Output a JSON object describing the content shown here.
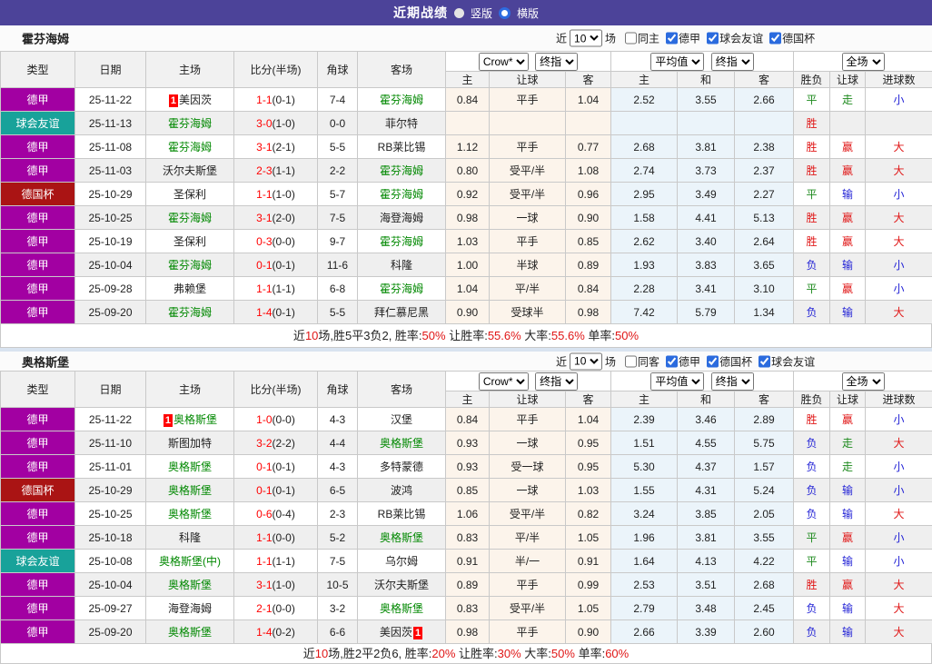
{
  "topbar": {
    "title": "近期战绩",
    "radio_vertical": "竖版",
    "radio_horizontal": "横版",
    "selected_layout": "竖版"
  },
  "labels": {
    "near": "近",
    "matches": "场"
  },
  "columns": {
    "type": "类型",
    "date": "日期",
    "home": "主场",
    "score": "比分(半场)",
    "corners": "角球",
    "away": "客场",
    "odds_home": "主",
    "odds_handicap": "让球",
    "odds_away": "客",
    "avg_home": "主",
    "avg_draw": "和",
    "avg_away": "客",
    "res_wdl": "胜负",
    "res_handicap": "让球",
    "res_goals": "进球数"
  },
  "colors": {
    "topbar_bg": "#4C4399",
    "league": "#A200A2",
    "friendly": "#18A29A",
    "cup": "#AA1414",
    "win_red": "#E01616",
    "draw_green": "#1E8A1E",
    "lose_blue": "#2424D6",
    "self_team_green": "#008800",
    "score_red": "#FF0000",
    "odds_bg": "#FCF4EB",
    "avg_bg": "#EBF4FA"
  },
  "sections": [
    {
      "team": "霍芬海姆",
      "filter": {
        "count": "10",
        "same": "同主",
        "same_checked": false,
        "comps": [
          {
            "label": "德甲",
            "checked": true
          },
          {
            "label": "球会友谊",
            "checked": true
          },
          {
            "label": "德国杯",
            "checked": true
          }
        ]
      },
      "selects": {
        "odds_source": "Crow*",
        "odds_type": "终指",
        "avg_source": "平均值",
        "avg_type": "终指",
        "scope": "全场"
      },
      "rows": [
        {
          "type": "德甲",
          "tc": "lg",
          "date": "25-11-22",
          "home": {
            "t": "美因茨",
            "self": false,
            "badge": "pre"
          },
          "score": "1-1",
          "half": "(0-1)",
          "corners": "7-4",
          "away": {
            "t": "霍芬海姆",
            "self": true
          },
          "odds": [
            "0.84",
            "平手",
            "1.04"
          ],
          "avg": [
            "2.52",
            "3.55",
            "2.66"
          ],
          "res": [
            {
              "t": "平",
              "c": "g"
            },
            {
              "t": "走",
              "c": "g"
            },
            {
              "t": "小",
              "c": "b"
            }
          ]
        },
        {
          "type": "球会友谊",
          "tc": "fr",
          "date": "25-11-13",
          "home": {
            "t": "霍芬海姆",
            "self": true
          },
          "score": "3-0",
          "half": "(1-0)",
          "corners": "0-0",
          "away": {
            "t": "菲尔特",
            "self": false
          },
          "odds": [
            "",
            "",
            ""
          ],
          "avg": [
            "",
            "",
            ""
          ],
          "res": [
            {
              "t": "胜",
              "c": "r"
            },
            {
              "t": "",
              "c": "k"
            },
            {
              "t": "",
              "c": "k"
            }
          ]
        },
        {
          "type": "德甲",
          "tc": "lg",
          "date": "25-11-08",
          "home": {
            "t": "霍芬海姆",
            "self": true
          },
          "score": "3-1",
          "half": "(2-1)",
          "corners": "5-5",
          "away": {
            "t": "RB莱比锡",
            "self": false
          },
          "odds": [
            "1.12",
            "平手",
            "0.77"
          ],
          "avg": [
            "2.68",
            "3.81",
            "2.38"
          ],
          "res": [
            {
              "t": "胜",
              "c": "r"
            },
            {
              "t": "赢",
              "c": "r"
            },
            {
              "t": "大",
              "c": "r"
            }
          ]
        },
        {
          "type": "德甲",
          "tc": "lg",
          "date": "25-11-03",
          "home": {
            "t": "沃尔夫斯堡",
            "self": false
          },
          "score": "2-3",
          "half": "(1-1)",
          "corners": "2-2",
          "away": {
            "t": "霍芬海姆",
            "self": true
          },
          "odds": [
            "0.80",
            "受平/半",
            "1.08"
          ],
          "avg": [
            "2.74",
            "3.73",
            "2.37"
          ],
          "res": [
            {
              "t": "胜",
              "c": "r"
            },
            {
              "t": "赢",
              "c": "r"
            },
            {
              "t": "大",
              "c": "r"
            }
          ]
        },
        {
          "type": "德国杯",
          "tc": "cup",
          "date": "25-10-29",
          "home": {
            "t": "圣保利",
            "self": false
          },
          "score": "1-1",
          "half": "(1-0)",
          "corners": "5-7",
          "away": {
            "t": "霍芬海姆",
            "self": true
          },
          "odds": [
            "0.92",
            "受平/半",
            "0.96"
          ],
          "avg": [
            "2.95",
            "3.49",
            "2.27"
          ],
          "res": [
            {
              "t": "平",
              "c": "g"
            },
            {
              "t": "输",
              "c": "b"
            },
            {
              "t": "小",
              "c": "b"
            }
          ]
        },
        {
          "type": "德甲",
          "tc": "lg",
          "date": "25-10-25",
          "home": {
            "t": "霍芬海姆",
            "self": true
          },
          "score": "3-1",
          "half": "(2-0)",
          "corners": "7-5",
          "away": {
            "t": "海登海姆",
            "self": false
          },
          "odds": [
            "0.98",
            "一球",
            "0.90"
          ],
          "avg": [
            "1.58",
            "4.41",
            "5.13"
          ],
          "res": [
            {
              "t": "胜",
              "c": "r"
            },
            {
              "t": "赢",
              "c": "r"
            },
            {
              "t": "大",
              "c": "r"
            }
          ]
        },
        {
          "type": "德甲",
          "tc": "lg",
          "date": "25-10-19",
          "home": {
            "t": "圣保利",
            "self": false
          },
          "score": "0-3",
          "half": "(0-0)",
          "corners": "9-7",
          "away": {
            "t": "霍芬海姆",
            "self": true
          },
          "odds": [
            "1.03",
            "平手",
            "0.85"
          ],
          "avg": [
            "2.62",
            "3.40",
            "2.64"
          ],
          "res": [
            {
              "t": "胜",
              "c": "r"
            },
            {
              "t": "赢",
              "c": "r"
            },
            {
              "t": "大",
              "c": "r"
            }
          ]
        },
        {
          "type": "德甲",
          "tc": "lg",
          "date": "25-10-04",
          "home": {
            "t": "霍芬海姆",
            "self": true
          },
          "score": "0-1",
          "half": "(0-1)",
          "corners": "11-6",
          "away": {
            "t": "科隆",
            "self": false
          },
          "odds": [
            "1.00",
            "半球",
            "0.89"
          ],
          "avg": [
            "1.93",
            "3.83",
            "3.65"
          ],
          "res": [
            {
              "t": "负",
              "c": "b"
            },
            {
              "t": "输",
              "c": "b"
            },
            {
              "t": "小",
              "c": "b"
            }
          ]
        },
        {
          "type": "德甲",
          "tc": "lg",
          "date": "25-09-28",
          "home": {
            "t": "弗赖堡",
            "self": false
          },
          "score": "1-1",
          "half": "(1-1)",
          "corners": "6-8",
          "away": {
            "t": "霍芬海姆",
            "self": true
          },
          "odds": [
            "1.04",
            "平/半",
            "0.84"
          ],
          "avg": [
            "2.28",
            "3.41",
            "3.10"
          ],
          "res": [
            {
              "t": "平",
              "c": "g"
            },
            {
              "t": "赢",
              "c": "r"
            },
            {
              "t": "小",
              "c": "b"
            }
          ]
        },
        {
          "type": "德甲",
          "tc": "lg",
          "date": "25-09-20",
          "home": {
            "t": "霍芬海姆",
            "self": true
          },
          "score": "1-4",
          "half": "(0-1)",
          "corners": "5-5",
          "away": {
            "t": "拜仁慕尼黑",
            "self": false
          },
          "odds": [
            "0.90",
            "受球半",
            "0.98"
          ],
          "avg": [
            "7.42",
            "5.79",
            "1.34"
          ],
          "res": [
            {
              "t": "负",
              "c": "b"
            },
            {
              "t": "输",
              "c": "b"
            },
            {
              "t": "大",
              "c": "r"
            }
          ]
        }
      ],
      "summary": [
        {
          "t": "近",
          "c": "k"
        },
        {
          "t": "10",
          "c": "r"
        },
        {
          "t": "场,胜5平3负2, 胜率:",
          "c": "k"
        },
        {
          "t": "50%",
          "c": "r"
        },
        {
          "t": " 让胜率:",
          "c": "k"
        },
        {
          "t": "55.6%",
          "c": "r"
        },
        {
          "t": " 大率:",
          "c": "k"
        },
        {
          "t": "55.6%",
          "c": "r"
        },
        {
          "t": " 单率:",
          "c": "k"
        },
        {
          "t": "50%",
          "c": "r"
        }
      ]
    },
    {
      "team": "奥格斯堡",
      "filter": {
        "count": "10",
        "same": "同客",
        "same_checked": false,
        "comps": [
          {
            "label": "德甲",
            "checked": true
          },
          {
            "label": "德国杯",
            "checked": true
          },
          {
            "label": "球会友谊",
            "checked": true
          }
        ]
      },
      "selects": {
        "odds_source": "Crow*",
        "odds_type": "终指",
        "avg_source": "平均值",
        "avg_type": "终指",
        "scope": "全场"
      },
      "rows": [
        {
          "type": "德甲",
          "tc": "lg",
          "date": "25-11-22",
          "home": {
            "t": "奥格斯堡",
            "self": true,
            "badge": "pre"
          },
          "score": "1-0",
          "half": "(0-0)",
          "corners": "4-3",
          "away": {
            "t": "汉堡",
            "self": false
          },
          "odds": [
            "0.84",
            "平手",
            "1.04"
          ],
          "avg": [
            "2.39",
            "3.46",
            "2.89"
          ],
          "res": [
            {
              "t": "胜",
              "c": "r"
            },
            {
              "t": "赢",
              "c": "r"
            },
            {
              "t": "小",
              "c": "b"
            }
          ]
        },
        {
          "type": "德甲",
          "tc": "lg",
          "date": "25-11-10",
          "home": {
            "t": "斯图加特",
            "self": false
          },
          "score": "3-2",
          "half": "(2-2)",
          "corners": "4-4",
          "away": {
            "t": "奥格斯堡",
            "self": true
          },
          "odds": [
            "0.93",
            "一球",
            "0.95"
          ],
          "avg": [
            "1.51",
            "4.55",
            "5.75"
          ],
          "res": [
            {
              "t": "负",
              "c": "b"
            },
            {
              "t": "走",
              "c": "g"
            },
            {
              "t": "大",
              "c": "r"
            }
          ]
        },
        {
          "type": "德甲",
          "tc": "lg",
          "date": "25-11-01",
          "home": {
            "t": "奥格斯堡",
            "self": true
          },
          "score": "0-1",
          "half": "(0-1)",
          "corners": "4-3",
          "away": {
            "t": "多特蒙德",
            "self": false
          },
          "odds": [
            "0.93",
            "受一球",
            "0.95"
          ],
          "avg": [
            "5.30",
            "4.37",
            "1.57"
          ],
          "res": [
            {
              "t": "负",
              "c": "b"
            },
            {
              "t": "走",
              "c": "g"
            },
            {
              "t": "小",
              "c": "b"
            }
          ]
        },
        {
          "type": "德国杯",
          "tc": "cup",
          "date": "25-10-29",
          "home": {
            "t": "奥格斯堡",
            "self": true
          },
          "score": "0-1",
          "half": "(0-1)",
          "corners": "6-5",
          "away": {
            "t": "波鸿",
            "self": false
          },
          "odds": [
            "0.85",
            "一球",
            "1.03"
          ],
          "avg": [
            "1.55",
            "4.31",
            "5.24"
          ],
          "res": [
            {
              "t": "负",
              "c": "b"
            },
            {
              "t": "输",
              "c": "b"
            },
            {
              "t": "小",
              "c": "b"
            }
          ]
        },
        {
          "type": "德甲",
          "tc": "lg",
          "date": "25-10-25",
          "home": {
            "t": "奥格斯堡",
            "self": true
          },
          "score": "0-6",
          "half": "(0-4)",
          "corners": "2-3",
          "away": {
            "t": "RB莱比锡",
            "self": false
          },
          "odds": [
            "1.06",
            "受平/半",
            "0.82"
          ],
          "avg": [
            "3.24",
            "3.85",
            "2.05"
          ],
          "res": [
            {
              "t": "负",
              "c": "b"
            },
            {
              "t": "输",
              "c": "b"
            },
            {
              "t": "大",
              "c": "r"
            }
          ]
        },
        {
          "type": "德甲",
          "tc": "lg",
          "date": "25-10-18",
          "home": {
            "t": "科隆",
            "self": false
          },
          "score": "1-1",
          "half": "(0-0)",
          "corners": "5-2",
          "away": {
            "t": "奥格斯堡",
            "self": true
          },
          "odds": [
            "0.83",
            "平/半",
            "1.05"
          ],
          "avg": [
            "1.96",
            "3.81",
            "3.55"
          ],
          "res": [
            {
              "t": "平",
              "c": "g"
            },
            {
              "t": "赢",
              "c": "r"
            },
            {
              "t": "小",
              "c": "b"
            }
          ]
        },
        {
          "type": "球会友谊",
          "tc": "fr",
          "date": "25-10-08",
          "home": {
            "t": "奥格斯堡(中)",
            "self": true
          },
          "score": "1-1",
          "half": "(1-1)",
          "corners": "7-5",
          "away": {
            "t": "乌尔姆",
            "self": false
          },
          "odds": [
            "0.91",
            "半/一",
            "0.91"
          ],
          "avg": [
            "1.64",
            "4.13",
            "4.22"
          ],
          "res": [
            {
              "t": "平",
              "c": "g"
            },
            {
              "t": "输",
              "c": "b"
            },
            {
              "t": "小",
              "c": "b"
            }
          ]
        },
        {
          "type": "德甲",
          "tc": "lg",
          "date": "25-10-04",
          "home": {
            "t": "奥格斯堡",
            "self": true
          },
          "score": "3-1",
          "half": "(1-0)",
          "corners": "10-5",
          "away": {
            "t": "沃尔夫斯堡",
            "self": false
          },
          "odds": [
            "0.89",
            "平手",
            "0.99"
          ],
          "avg": [
            "2.53",
            "3.51",
            "2.68"
          ],
          "res": [
            {
              "t": "胜",
              "c": "r"
            },
            {
              "t": "赢",
              "c": "r"
            },
            {
              "t": "大",
              "c": "r"
            }
          ]
        },
        {
          "type": "德甲",
          "tc": "lg",
          "date": "25-09-27",
          "home": {
            "t": "海登海姆",
            "self": false
          },
          "score": "2-1",
          "half": "(0-0)",
          "corners": "3-2",
          "away": {
            "t": "奥格斯堡",
            "self": true
          },
          "odds": [
            "0.83",
            "受平/半",
            "1.05"
          ],
          "avg": [
            "2.79",
            "3.48",
            "2.45"
          ],
          "res": [
            {
              "t": "负",
              "c": "b"
            },
            {
              "t": "输",
              "c": "b"
            },
            {
              "t": "大",
              "c": "r"
            }
          ]
        },
        {
          "type": "德甲",
          "tc": "lg",
          "date": "25-09-20",
          "home": {
            "t": "奥格斯堡",
            "self": true
          },
          "score": "1-4",
          "half": "(0-2)",
          "corners": "6-6",
          "away": {
            "t": "美因茨",
            "self": false,
            "badge": "post"
          },
          "odds": [
            "0.98",
            "平手",
            "0.90"
          ],
          "avg": [
            "2.66",
            "3.39",
            "2.60"
          ],
          "res": [
            {
              "t": "负",
              "c": "b"
            },
            {
              "t": "输",
              "c": "b"
            },
            {
              "t": "大",
              "c": "r"
            }
          ]
        }
      ],
      "summary": [
        {
          "t": "近",
          "c": "k"
        },
        {
          "t": "10",
          "c": "r"
        },
        {
          "t": "场,胜2平2负6, 胜率:",
          "c": "k"
        },
        {
          "t": "20%",
          "c": "r"
        },
        {
          "t": " 让胜率:",
          "c": "k"
        },
        {
          "t": "30%",
          "c": "r"
        },
        {
          "t": " 大率:",
          "c": "k"
        },
        {
          "t": "50%",
          "c": "r"
        },
        {
          "t": " 单率:",
          "c": "k"
        },
        {
          "t": "60%",
          "c": "r"
        }
      ]
    }
  ]
}
